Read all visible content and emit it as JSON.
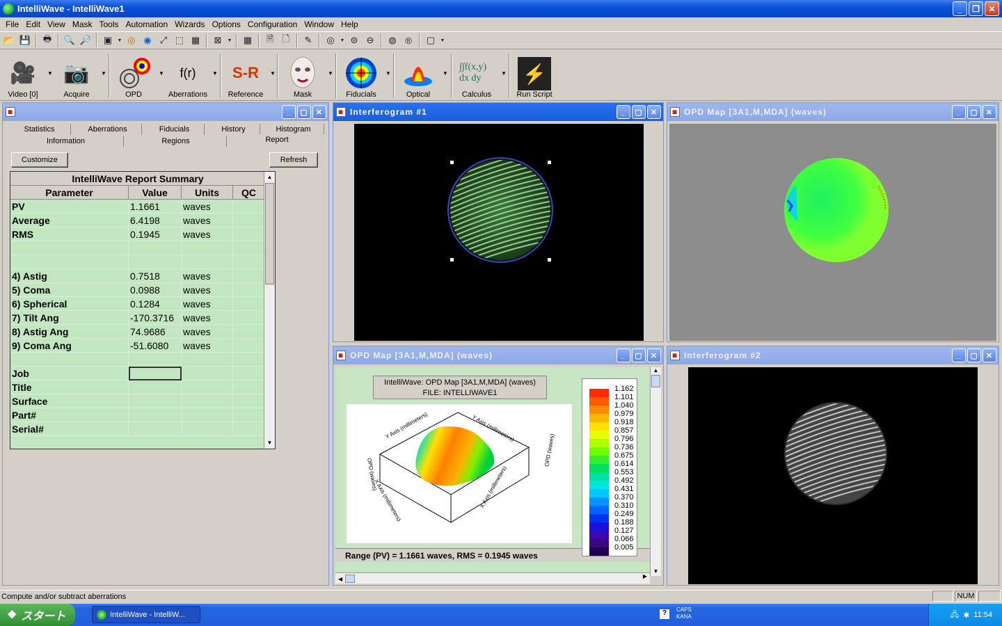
{
  "window": {
    "title": "IntelliWave - IntelliWave1"
  },
  "menu": [
    "File",
    "Edit",
    "View",
    "Mask",
    "Tools",
    "Automation",
    "Wizards",
    "Options",
    "Configuration",
    "Window",
    "Help"
  ],
  "big_toolbar": [
    {
      "label": "Video [0]",
      "icon": "video-camera-icon"
    },
    {
      "label": "Acquire",
      "icon": "acquire-camera-icon"
    },
    {
      "label": "OPD",
      "icon": "opd-icon"
    },
    {
      "label": "Aberrations",
      "icon": "aberrations-icon",
      "glyph": "f(r)"
    },
    {
      "label": "Reference",
      "icon": "reference-icon",
      "glyph": "S-R"
    },
    {
      "label": "Mask",
      "icon": "mask-icon"
    },
    {
      "label": "Fiducials",
      "icon": "fiducials-icon"
    },
    {
      "label": "Optical",
      "icon": "optical-icon"
    },
    {
      "label": "Calculus",
      "icon": "calculus-icon",
      "glyph": "∫∫f(x,y) dx dy"
    },
    {
      "label": "Run Script",
      "icon": "run-script-icon"
    }
  ],
  "analysis": {
    "tabs_row1": [
      "Statistics",
      "Aberrations",
      "Fiducials",
      "History",
      "Histogram"
    ],
    "tabs_row2": [
      "Information",
      "Regions",
      "Report"
    ],
    "customize": "Customize",
    "refresh": "Refresh",
    "report_title": "IntelliWave Report Summary",
    "columns": [
      "Parameter",
      "Value",
      "Units",
      "QC"
    ],
    "rows": [
      {
        "p": "PV",
        "v": "1.1661",
        "u": "waves"
      },
      {
        "p": "Average",
        "v": "6.4198",
        "u": "waves"
      },
      {
        "p": "RMS",
        "v": "0.1945",
        "u": "waves"
      },
      {
        "p": "",
        "v": "",
        "u": ""
      },
      {
        "p": "",
        "v": "",
        "u": ""
      },
      {
        "p": " 4) Astig",
        "v": "0.7518",
        "u": "waves"
      },
      {
        "p": " 5) Coma",
        "v": "0.0988",
        "u": "waves"
      },
      {
        "p": " 6) Spherical",
        "v": "0.1284",
        "u": "waves"
      },
      {
        "p": " 7) Tilt Ang",
        "v": "-170.3716",
        "u": "waves"
      },
      {
        "p": " 8) Astig Ang",
        "v": "74.9686",
        "u": "waves"
      },
      {
        "p": " 9) Coma Ang",
        "v": "-51.6080",
        "u": "waves"
      },
      {
        "p": "",
        "v": "",
        "u": ""
      },
      {
        "p": "Job",
        "v": "",
        "u": ""
      },
      {
        "p": "Title",
        "v": "",
        "u": ""
      },
      {
        "p": "Surface",
        "v": "",
        "u": ""
      },
      {
        "p": "Part#",
        "v": "",
        "u": ""
      },
      {
        "p": "Serial#",
        "v": "",
        "u": ""
      }
    ]
  },
  "windows": {
    "interferogram1": "Interferogram #1",
    "opd_top": "OPD Map [3A1,M,MDA]  (waves)",
    "opd_bottom": "OPD Map [3A1,M,MDA]  (waves)",
    "interferogram2": "Interferogram #2"
  },
  "opd3d": {
    "caption1": "IntelliWave: OPD Map [3A1,M,MDA]  (waves)",
    "caption2": "FILE: INTELLIWAVE1",
    "range_text": "Range (PV) =   1.1661 waves, RMS =   0.1945 waves",
    "legend": [
      "1.162",
      "1.101",
      "1.040",
      "0.979",
      "0.918",
      "0.857",
      "0.796",
      "0.736",
      "0.675",
      "0.614",
      "0.553",
      "0.492",
      "0.431",
      "0.370",
      "0.310",
      "0.249",
      "0.188",
      "0.127",
      "0.066",
      "0.005"
    ],
    "legend_colors": [
      "#ff2a00",
      "#ff5a00",
      "#ff8a00",
      "#ffb800",
      "#ffe000",
      "#e6ff00",
      "#b0ff00",
      "#70ff00",
      "#30f030",
      "#00e060",
      "#00e0a0",
      "#00e6e0",
      "#00c8ff",
      "#0096ff",
      "#0064ff",
      "#0032f0",
      "#1a10d8",
      "#3a08b0",
      "#3a0880",
      "#200050"
    ]
  },
  "status": {
    "text": "Compute and/or subtract aberrations",
    "num": "NUM"
  },
  "taskbar": {
    "start": "スタート",
    "item": "IntelliWave - IntelliW...",
    "caps": "CAPS",
    "kana": "KANA",
    "time": "11:54"
  }
}
